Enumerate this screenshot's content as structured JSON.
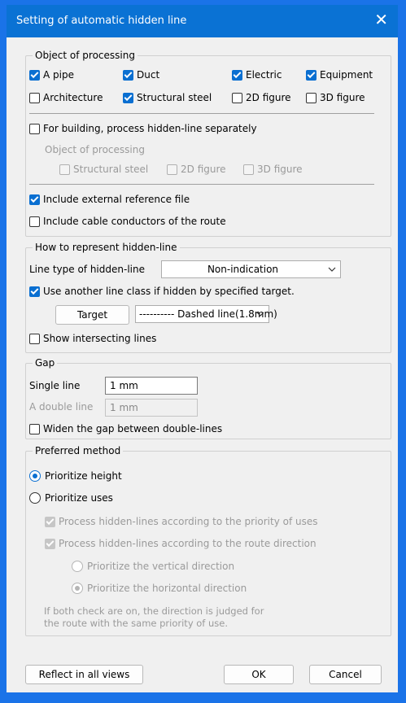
{
  "window": {
    "title": "Setting of automatic hidden line"
  },
  "object_group": {
    "legend": "Object of processing",
    "checks": [
      {
        "label": "A pipe",
        "checked": true
      },
      {
        "label": "Duct",
        "checked": true
      },
      {
        "label": "Electric",
        "checked": true
      },
      {
        "label": "Equipment",
        "checked": true
      },
      {
        "label": "Architecture",
        "checked": false
      },
      {
        "label": "Structural steel",
        "checked": true
      },
      {
        "label": "2D figure",
        "checked": false
      },
      {
        "label": "3D figure",
        "checked": false
      }
    ],
    "building_separately": "For building, process hidden-line separately",
    "sub_label": "Object of processing",
    "sub_checks": [
      "Structural steel",
      "2D figure",
      "3D figure"
    ],
    "include_external": "Include external reference file",
    "include_cable": "Include cable conductors of the route"
  },
  "represent_group": {
    "legend": "How to represent hidden-line",
    "line_type_label": "Line type of hidden-line",
    "line_type_value": "Non-indication",
    "use_another_label": "Use another line class if hidden by specified target.",
    "target_button": "Target",
    "dashed_value": "---------- Dashed line(1.8mm)",
    "show_intersecting": "Show intersecting lines"
  },
  "gap_group": {
    "legend": "Gap",
    "single_label": "Single line",
    "single_value": "1 mm",
    "double_label": "A double line",
    "double_value": "1 mm",
    "widen_label": "Widen the gap between double-lines"
  },
  "preferred_group": {
    "legend": "Preferred method",
    "prioritize_height": "Prioritize height",
    "prioritize_uses": "Prioritize uses",
    "process_priority": "Process hidden-lines according to the priority of uses",
    "process_route": "Process hidden-lines according to the route direction",
    "vertical": "Prioritize the vertical direction",
    "horizontal": "Prioritize the horizontal direction",
    "note_line1": "If both check are on, the direction is judged for",
    "note_line2": "the route with the same priority of use."
  },
  "footer": {
    "reflect": "Reflect in all views",
    "ok": "OK",
    "cancel": "Cancel"
  },
  "colors": {
    "accent": "#0a6fd1",
    "titlebar": "#0a72d4",
    "background": "#f0f0f0"
  }
}
